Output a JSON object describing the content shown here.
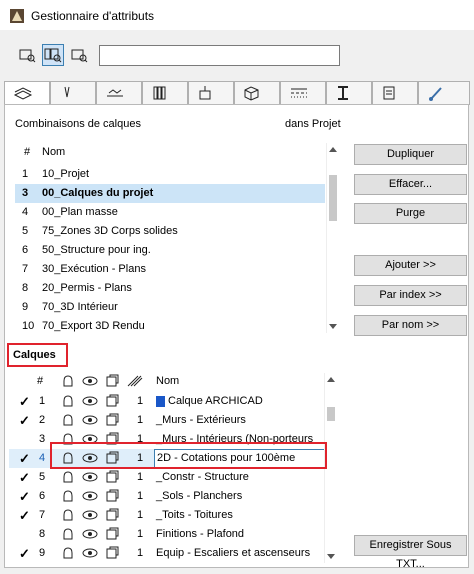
{
  "window": {
    "title": "Gestionnaire d'attributs"
  },
  "search": {
    "value": "",
    "placeholder": ""
  },
  "toolbar": {
    "icons": [
      "list-view-icon",
      "list-view-selected-icon",
      "preview-view-icon"
    ]
  },
  "tabs": [
    "layers-tab",
    "pens-tab",
    "fills-tab",
    "composites-tab",
    "profiles-tab",
    "surfaces-tab",
    "building-materials-tab",
    "lines-tab",
    "zones-tab",
    "zone-categories-tab",
    "mep-tab"
  ],
  "combinations": {
    "heading": "Combinaisons de calques",
    "context": "dans Projet",
    "col_num": "#",
    "col_name": "Nom",
    "rows": [
      {
        "num": "1",
        "name": "10_Projet",
        "selected": false
      },
      {
        "num": "3",
        "name": "00_Calques du projet",
        "selected": true
      },
      {
        "num": "4",
        "name": "00_Plan masse",
        "selected": false
      },
      {
        "num": "5",
        "name": "75_Zones 3D Corps solides",
        "selected": false
      },
      {
        "num": "6",
        "name": "50_Structure pour ing.",
        "selected": false
      },
      {
        "num": "7",
        "name": "30_Exécution - Plans",
        "selected": false
      },
      {
        "num": "8",
        "name": "20_Permis - Plans",
        "selected": false
      },
      {
        "num": "9",
        "name": "70_3D Intérieur",
        "selected": false
      },
      {
        "num": "10",
        "name": "70_Export 3D Rendu",
        "selected": false
      }
    ]
  },
  "buttons": {
    "dupliquer": "Dupliquer",
    "effacer": "Effacer...",
    "purge": "Purge",
    "ajouter": "Ajouter >>",
    "par_index": "Par index >>",
    "par_nom": "Par nom >>",
    "enregistrer": "Enregistrer Sous TXT..."
  },
  "layers": {
    "heading": "Calques",
    "col_num": "#",
    "col_name": "Nom",
    "rows": [
      {
        "check": "✓",
        "num": "1",
        "pen": "1",
        "name": "Calque ARCHICAD",
        "special": true
      },
      {
        "check": "✓",
        "num": "2",
        "pen": "1",
        "name": "_Murs - Extérieurs"
      },
      {
        "check": "",
        "num": "3",
        "pen": "1",
        "name": "_Murs - Intérieurs (Non-porteurs"
      },
      {
        "check": "✓",
        "num": "4",
        "pen": "1",
        "name": "2D - Cotations pour 100ème",
        "editing": true
      },
      {
        "check": "✓",
        "num": "5",
        "pen": "1",
        "name": "_Constr - Structure"
      },
      {
        "check": "✓",
        "num": "6",
        "pen": "1",
        "name": "_Sols - Planchers"
      },
      {
        "check": "✓",
        "num": "7",
        "pen": "1",
        "name": "_Toits - Toitures"
      },
      {
        "check": "",
        "num": "8",
        "pen": "1",
        "name": "Finitions - Plafond"
      },
      {
        "check": "✓",
        "num": "9",
        "pen": "1",
        "name": "Equip - Escaliers et ascenseurs"
      }
    ]
  }
}
